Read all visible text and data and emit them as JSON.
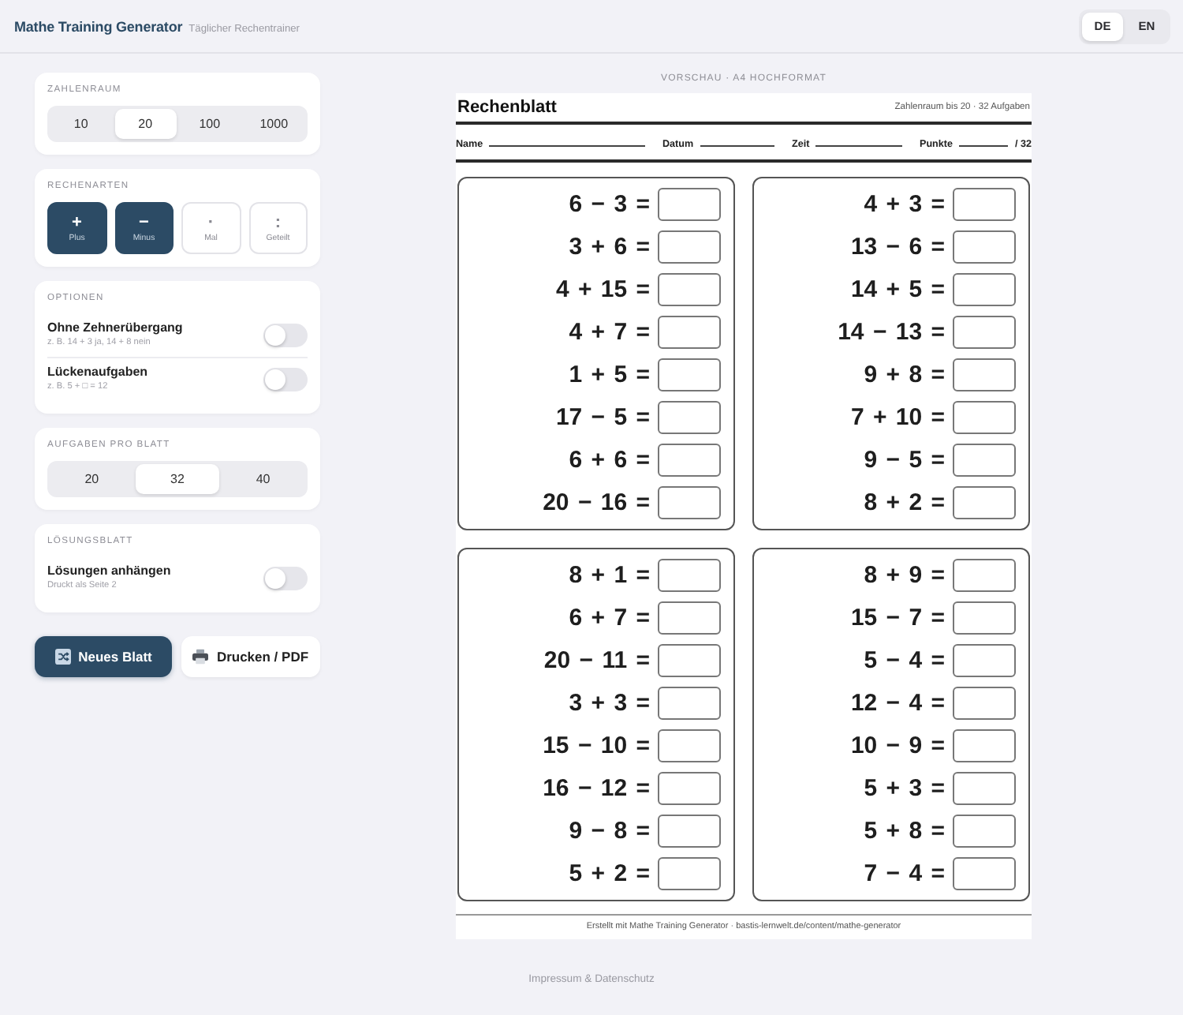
{
  "header": {
    "title": "Mathe Training Generator",
    "subtitle": "Täglicher Rechentrainer"
  },
  "language": [
    {
      "label": "DE",
      "selected": true
    },
    {
      "label": "EN",
      "selected": false
    }
  ],
  "sidebar": {
    "sections": [
      {
        "kind": "segmented",
        "title": "ZAHLENRAUM",
        "options": [
          {
            "label": "10",
            "selected": false
          },
          {
            "label": "20",
            "selected": true
          },
          {
            "label": "100",
            "selected": false
          },
          {
            "label": "1000",
            "selected": false
          }
        ]
      },
      {
        "kind": "operations",
        "title": "RECHENARTEN",
        "options": [
          {
            "symbol": "+",
            "label": "Plus",
            "selected": true
          },
          {
            "symbol": "−",
            "label": "Minus",
            "selected": true
          },
          {
            "symbol": "·",
            "label": "Mal",
            "selected": false
          },
          {
            "symbol": ":",
            "label": "Geteilt",
            "selected": false
          }
        ]
      },
      {
        "kind": "toggles",
        "title": "OPTIONEN",
        "items": [
          {
            "label": "Ohne Zehnerübergang",
            "hint": "z. B. 14 + 3 ja, 14 + 8 nein",
            "on": false
          },
          {
            "label": "Lückenaufgaben",
            "hint": "z. B. 5 + □ = 12",
            "on": false
          }
        ]
      },
      {
        "kind": "segmented",
        "title": "AUFGABEN PRO BLATT",
        "options": [
          {
            "label": "20",
            "selected": false
          },
          {
            "label": "32",
            "selected": true
          },
          {
            "label": "40",
            "selected": false
          }
        ]
      },
      {
        "kind": "toggles",
        "title": "LÖSUNGSBLATT",
        "items": [
          {
            "label": "Lösungen anhängen",
            "hint": "Druckt als Seite 2",
            "on": false
          }
        ]
      }
    ]
  },
  "actions": [
    {
      "kind": "new",
      "label": "Neues Blatt"
    },
    {
      "kind": "print",
      "label": "Drucken / PDF"
    }
  ],
  "preview": {
    "caption": "VORSCHAU · A4 HOCHFORMAT",
    "sheet": {
      "title": "Rechenblatt",
      "meta": "Zahlenraum bis 20 · 32 Aufgaben",
      "fields": [
        {
          "label": "Name"
        },
        {
          "label": "Datum"
        },
        {
          "label": "Zeit"
        },
        {
          "label": "Punkte",
          "suffix": "/ 32"
        }
      ],
      "blocks": [
        {
          "problems": [
            "6 − 3 =",
            "3 + 6 =",
            "4 + 15 =",
            "4 + 7 =",
            "1 + 5 =",
            "17 − 5 =",
            "6 + 6 =",
            "20 − 16 ="
          ]
        },
        {
          "problems": [
            "4 + 3 =",
            "13 − 6 =",
            "14 + 5 =",
            "14 − 13 =",
            "9 + 8 =",
            "7 + 10 =",
            "9 − 5 =",
            "8 + 2 ="
          ]
        },
        {
          "problems": [
            "8 + 1 =",
            "6 + 7 =",
            "20 − 11 =",
            "3 + 3 =",
            "15 − 10 =",
            "16 − 12 =",
            "9 − 8 =",
            "5 + 2 ="
          ]
        },
        {
          "problems": [
            "8 + 9 =",
            "15 − 7 =",
            "5 − 4 =",
            "12 − 4 =",
            "10 − 9 =",
            "5 + 3 =",
            "5 + 8 =",
            "7 − 4 ="
          ]
        }
      ],
      "footer": "Erstellt mit Mathe Training Generator · bastis-lernwelt.de/content/mathe-generator"
    }
  },
  "footer": {
    "link": "Impressum & Datenschutz"
  }
}
